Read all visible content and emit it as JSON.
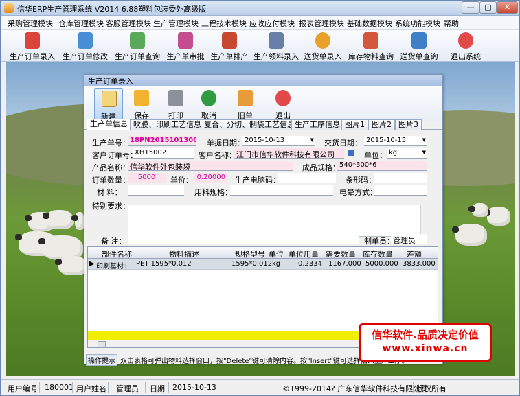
{
  "window": {
    "title": "信华ERP生产管理系统  V2014  6.88塑料包装委外高级版",
    "min_label": "—",
    "max_label": "□",
    "close_label": "✕"
  },
  "menu": [
    "采购管理模块",
    "仓库管理模块",
    "客服管理模块",
    "生产管理模块",
    "工程技术模块",
    "应收应付模块",
    "报表管理模块",
    "基础数据模块",
    "系统功能模块",
    "帮助"
  ],
  "toolbar": [
    {
      "label": "生产订单录入",
      "icon": "pdf-document-icon",
      "color": "#d9453a"
    },
    {
      "label": "生产订单修改",
      "icon": "pen-edit-icon",
      "color": "#4a8fd6"
    },
    {
      "label": "生产订单查询",
      "icon": "search-book-icon",
      "color": "#5aa85a"
    },
    {
      "label": "生产单审批",
      "icon": "approve-pen-icon",
      "color": "#c34d8f"
    },
    {
      "label": "生产单排产",
      "icon": "schedule-pen-icon",
      "color": "#c8472f"
    },
    {
      "label": "生产领料录入",
      "icon": "material-box-icon",
      "color": "#6a7fa8"
    },
    {
      "label": "送货单录入",
      "icon": "flower-icon",
      "color": "#e9a227"
    },
    {
      "label": "库存物料查询",
      "icon": "feather-icon",
      "color": "#d4573a"
    },
    {
      "label": "送货单查询",
      "icon": "delivery-query-icon",
      "color": "#3f7fc8"
    },
    {
      "label": "退出系统",
      "icon": "power-icon",
      "color": "#e14a4a"
    }
  ],
  "child": {
    "title": "生产订单录入",
    "tools": [
      {
        "label": "新建",
        "icon": "new-document-icon",
        "color": "#f4d67a"
      },
      {
        "label": "保存",
        "icon": "save-disk-icon",
        "color": "#f2b330"
      },
      {
        "label": "打印",
        "icon": "printer-icon",
        "color": "#8b9099"
      },
      {
        "label": "取消",
        "icon": "undo-arrow-icon",
        "color": "#2f9c3f"
      },
      {
        "label": "旧单",
        "icon": "old-order-icon",
        "color": "#e79b3b"
      },
      {
        "label": "退出",
        "icon": "exit-icon",
        "color": "#e14a4a"
      }
    ],
    "tabs": [
      "生产单信息",
      "吹膜、印刷工艺信息",
      "复合、分切、制袋工艺信息",
      "生产工序信息",
      "图片1",
      "图片2",
      "图片3"
    ],
    "form": {
      "order_no_label": "生产单号：",
      "order_no": "18PN20151013001",
      "doc_date_label": "单据日期：",
      "doc_date": "2015-10-13",
      "delivery_label": "交货日期：",
      "delivery": "2015-10-15",
      "cust_order_label": "客户订单号：",
      "cust_order": "XH15002",
      "cust_name_label": "客户名称：",
      "cust_name": "江门市信华软件科技有限公司",
      "unit_label": "单位：",
      "unit": "kg",
      "product_label": "产品名称：",
      "product": "信华软件外包装袋",
      "spec_label": "成品规格：",
      "spec": "540*300*6",
      "qty_label": "订单数量：",
      "qty": "5000",
      "price_label": "单价：",
      "price": "0.20000",
      "pc_code_label": "生产电脑码：",
      "pc_code": "",
      "barcode_label": "条形码：",
      "barcode": "",
      "material_label": "材  料：",
      "material": "",
      "mat_spec_label": "用料规格：",
      "mat_spec": "",
      "stack_label": "电晕方式：",
      "stack": "",
      "special_label": "特别要求：",
      "special": "",
      "remark_label": "备  注：",
      "remark": "",
      "maker_label": "制单员：",
      "maker": "管理员"
    },
    "grid": {
      "headers": [
        "部件名称",
        "物料描述",
        "规格型号",
        "单位",
        "单位用量",
        "需要数量",
        "库存数量",
        "差额"
      ],
      "row": {
        "marker": "▶",
        "part": "印刷基材1",
        "desc": "PET 1595*0.012",
        "spec": "1595*0.012",
        "unit": "kg",
        "usage": "0.2334",
        "need": "1167.000",
        "stock": "5000.000",
        "diff": "3833.000"
      }
    },
    "hint_label": "操作提示",
    "hint_text": "双击表格可弹出物料选择窗口，按\"Delete\"键可清除内容。按\"Insert\"键可选择插入生产工序。"
  },
  "stamp": {
    "line1": "信华软件.品质决定价值",
    "line2": "www.xinwa.cn"
  },
  "status": {
    "user_no_label": "用户编号",
    "user_no": "180001",
    "user_name_label": "用户姓名",
    "user_name": "管理员",
    "date_label": "日期",
    "date": "2015-10-13",
    "copyright": "©1999-2014?  广东信华软件科技有限公司",
    "rights": "版权所有"
  }
}
